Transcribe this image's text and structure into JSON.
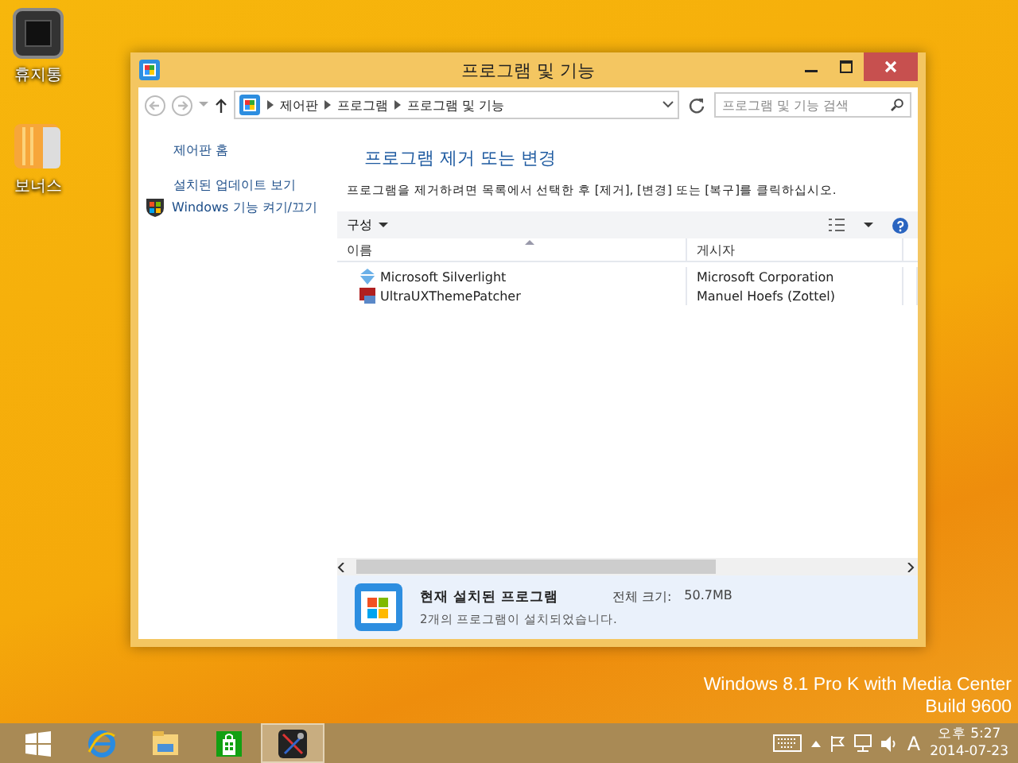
{
  "desktop_icons": [
    {
      "label": "휴지통",
      "kind": "bin"
    },
    {
      "label": "보너스",
      "kind": "folder"
    }
  ],
  "window": {
    "title": "프로그램 및 기능",
    "breadcrumb": [
      "제어판",
      "프로그램",
      "프로그램 및 기능"
    ],
    "search": {
      "placeholder": "프로그램 및 기능 검색"
    },
    "sidebar": {
      "items": [
        {
          "label": "제어판 홈",
          "kind": "link"
        },
        {
          "label": "설치된 업데이트 보기",
          "kind": "link"
        },
        {
          "label": "Windows 기능 켜기/끄기",
          "kind": "shield"
        }
      ]
    },
    "heading": "프로그램 제거 또는 변경",
    "instructions": "프로그램을 제거하려면 목록에서 선택한 후 [제거], [변경] 또는 [복구]를 클릭하십시오.",
    "toolbar": {
      "organize": "구성"
    },
    "table": {
      "columns": [
        "이름",
        "게시자"
      ],
      "rows": [
        {
          "name": "Microsoft Silverlight",
          "publisher": "Microsoft Corporation",
          "kind": "silverlight"
        },
        {
          "name": "UltraUXThemePatcher",
          "publisher": "Manuel Hoefs (Zottel)",
          "kind": "patcher"
        }
      ]
    },
    "details": {
      "title": "현재 설치된 프로그램",
      "size_label": "전체 크기:",
      "size": "50.7MB",
      "count": "2개의 프로그램이 설치되었습니다."
    }
  },
  "desktop_version": [
    "Windows 8.1 Pro K with Media Center",
    "Build 9600"
  ],
  "taskbar": {
    "apps": [
      {
        "kind": "ie",
        "selected": false
      },
      {
        "kind": "explorer",
        "selected": false
      },
      {
        "kind": "store",
        "selected": false
      },
      {
        "kind": "tools",
        "selected": true
      }
    ],
    "ime": "A",
    "clock": {
      "time": "오후 5:27",
      "date": "2014-07-23"
    }
  }
}
